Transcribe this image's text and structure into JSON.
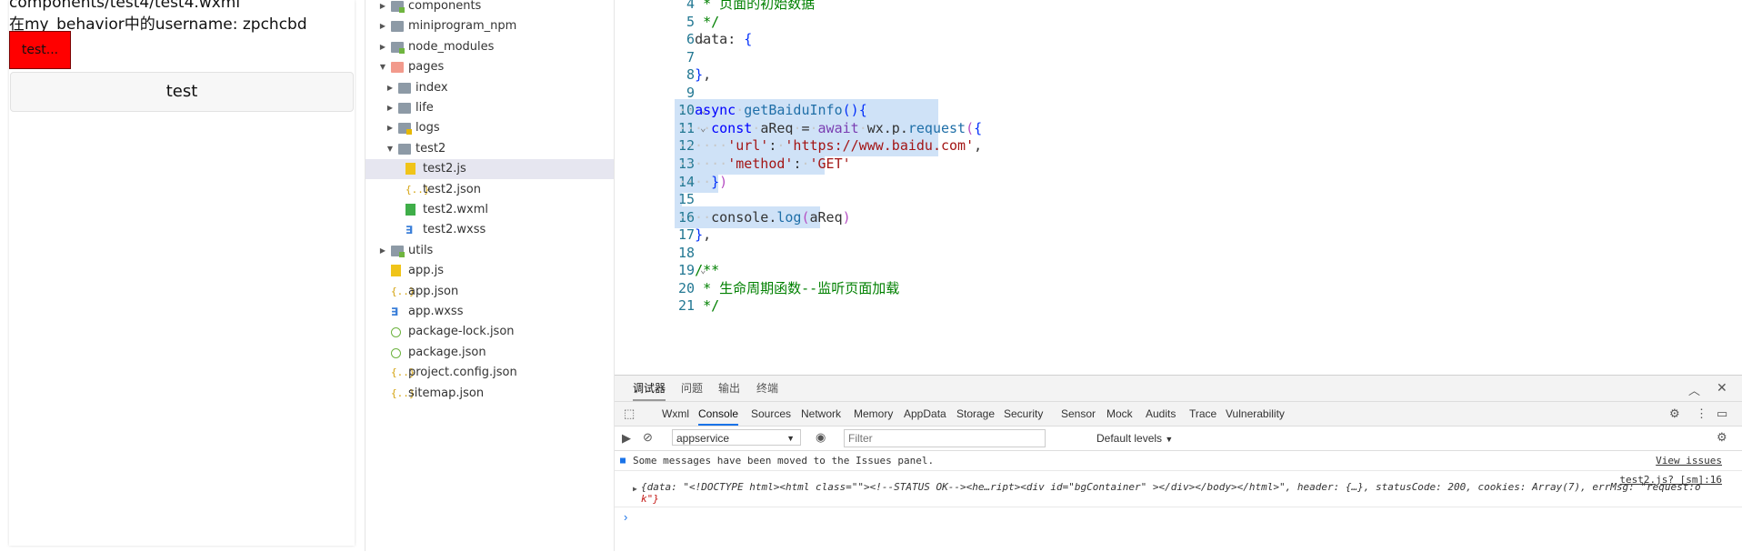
{
  "simulator": {
    "line1": "components/test4/test4.wxml",
    "line2": "在my_behavior中的username: zpchcbd",
    "red_button": "test...",
    "test_button": "test"
  },
  "tree": [
    {
      "label": "components",
      "depth": 0,
      "arrow": "▸",
      "icon": "folder-green"
    },
    {
      "label": "miniprogram_npm",
      "depth": 0,
      "arrow": "▸",
      "icon": "folder"
    },
    {
      "label": "node_modules",
      "depth": 0,
      "arrow": "▸",
      "icon": "folder-green"
    },
    {
      "label": "pages",
      "depth": 0,
      "arrow": "▾",
      "icon": "folder-red"
    },
    {
      "label": "index",
      "depth": 1,
      "arrow": "▸",
      "icon": "folder"
    },
    {
      "label": "life",
      "depth": 1,
      "arrow": "▸",
      "icon": "folder"
    },
    {
      "label": "logs",
      "depth": 1,
      "arrow": "▸",
      "icon": "folder-yellow"
    },
    {
      "label": "test2",
      "depth": 1,
      "arrow": "▾",
      "icon": "folder"
    },
    {
      "label": "test2.js",
      "depth": 2,
      "arrow": "",
      "icon": "js",
      "selected": true
    },
    {
      "label": "test2.json",
      "depth": 2,
      "arrow": "",
      "icon": "json"
    },
    {
      "label": "test2.wxml",
      "depth": 2,
      "arrow": "",
      "icon": "wxml"
    },
    {
      "label": "test2.wxss",
      "depth": 2,
      "arrow": "",
      "icon": "wxss"
    },
    {
      "label": "utils",
      "depth": 0,
      "arrow": "▸",
      "icon": "folder-green"
    },
    {
      "label": "app.js",
      "depth": 0,
      "arrow": "",
      "icon": "js"
    },
    {
      "label": "app.json",
      "depth": 0,
      "arrow": "",
      "icon": "json"
    },
    {
      "label": "app.wxss",
      "depth": 0,
      "arrow": "",
      "icon": "wxss"
    },
    {
      "label": "package-lock.json",
      "depth": 0,
      "arrow": "",
      "icon": "pkg"
    },
    {
      "label": "package.json",
      "depth": 0,
      "arrow": "",
      "icon": "pkg"
    },
    {
      "label": "project.config.json",
      "depth": 0,
      "arrow": "",
      "icon": "json"
    },
    {
      "label": "sitemap.json",
      "depth": 0,
      "arrow": "",
      "icon": "json"
    }
  ],
  "editor": {
    "lines": [
      {
        "n": "4",
        "fold": "",
        "hl": 0,
        "html": "   <span class='cm'>* 页面的初始数据</span>"
      },
      {
        "n": "5",
        "fold": "",
        "hl": 0,
        "html": "   <span class='cm'>*/</span>"
      },
      {
        "n": "6",
        "fold": "⌄",
        "hl": 0,
        "html": "  <span class='pl'>data</span>: <span class='br1'>{</span>"
      },
      {
        "n": "7",
        "fold": "",
        "hl": 0,
        "html": ""
      },
      {
        "n": "8",
        "fold": "",
        "hl": 0,
        "html": "  <span class='br1'>}</span>,"
      },
      {
        "n": "9",
        "fold": "",
        "hl": 0,
        "html": ""
      },
      {
        "n": "10",
        "fold": "⌄",
        "hl": 290,
        "html": "<span class='ws'>··</span><span class='kb'>async</span><span class='ws'>·</span><span class='fn'>getBaiduInfo</span><span class='br1'>()</span><span class='br1'>{</span>"
      },
      {
        "n": "11",
        "fold": "⌄",
        "hl": 290,
        "html": "<span class='ws'>····</span><span class='kb'>const</span><span class='ws'>·</span><span class='pl'>aReq</span><span class='ws'>·</span>=<span class='ws'>·</span><span class='k'>await</span><span class='ws'>·</span><span class='pl'>wx.p.</span><span class='fn'>request</span><span class='br2'>(</span><span class='br1'>{</span>"
      },
      {
        "n": "12",
        "fold": "",
        "hl": 290,
        "html": "<span class='ws'>······</span><span class='str'>'url'</span>:<span class='ws'>·</span><span class='str'>'https://www.baidu.com'</span>,"
      },
      {
        "n": "13",
        "fold": "",
        "hl": 165,
        "html": "<span class='ws'>······</span><span class='str'>'method'</span>:<span class='ws'>·</span><span class='str'>'GET'</span>"
      },
      {
        "n": "14",
        "fold": "",
        "hl": 48,
        "html": "<span class='ws'>····</span><span class='br1'>}</span><span class='br2'>)</span>"
      },
      {
        "n": "15",
        "fold": "",
        "hl": 8,
        "html": ""
      },
      {
        "n": "16",
        "fold": "",
        "hl": 160,
        "html": "<span class='ws'>····</span><span class='pl'>console.</span><span class='fn'>log</span><span class='br2'>(</span><span class='pl'>aReq</span><span class='br2'>)</span>"
      },
      {
        "n": "17",
        "fold": "",
        "hl": 0,
        "html": "  <span class='br1'>}</span>,"
      },
      {
        "n": "18",
        "fold": "",
        "hl": 0,
        "html": ""
      },
      {
        "n": "19",
        "fold": "⌄",
        "hl": 0,
        "html": "  <span class='cm'>/**</span>"
      },
      {
        "n": "20",
        "fold": "",
        "hl": 0,
        "html": "   <span class='cm'>* 生命周期函数--监听页面加载</span>"
      },
      {
        "n": "21",
        "fold": "",
        "hl": 0,
        "html": "   <span class='cm'>*/</span>"
      }
    ]
  },
  "devtools": {
    "top_tabs": [
      "调试器",
      "问题",
      "输出",
      "终端"
    ],
    "tabs": [
      "Wxml",
      "Console",
      "Sources",
      "Network",
      "Memory",
      "AppData",
      "Storage",
      "Security",
      "Sensor",
      "Mock",
      "Audits",
      "Trace",
      "Vulnerability"
    ],
    "active_tab": "Console",
    "context": "appservice",
    "filter_placeholder": "Filter",
    "levels": "Default levels",
    "msg_moved": "Some messages have been moved to the Issues panel.",
    "view_issues": "View issues",
    "source_link": "test2.js? [sm]:16",
    "log_line1": "{data: \"<!DOCTYPE html><html class=\"\"><!--STATUS OK--><he…ript><div id=\"bgContainer\" ></div></body></html>\", header: {…}, statusCode: 200, cookies: Array(7), errMsg: \"request:o",
    "log_line2": "k\"}"
  }
}
